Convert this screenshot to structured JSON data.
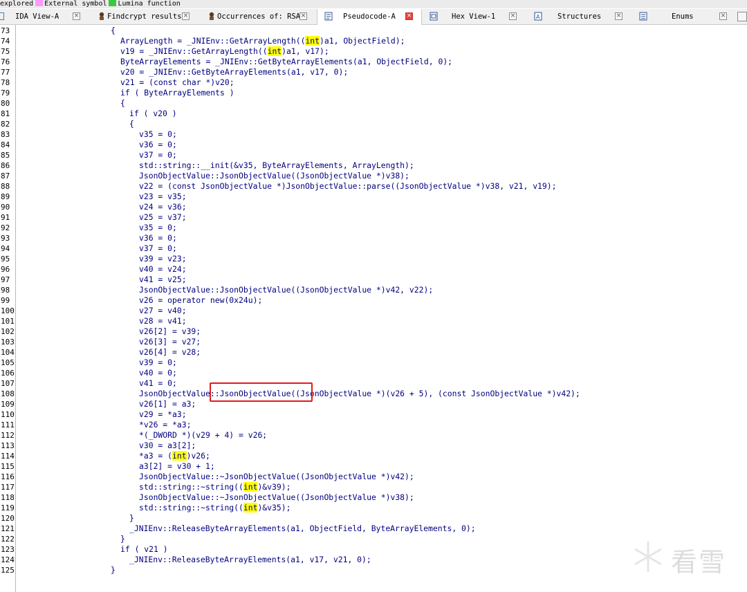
{
  "legend": {
    "items": [
      {
        "label": "explored",
        "color": null
      },
      {
        "label": "External symbol",
        "color": "#ff99ff"
      },
      {
        "label": "Lumina function",
        "color": "#3cc83c"
      }
    ]
  },
  "tabs": [
    {
      "label": "IDA View-A",
      "icon": "ida-view-icon",
      "active": false
    },
    {
      "label": "Findcrypt results",
      "icon": "findcrypt-icon",
      "active": false
    },
    {
      "label": "Occurrences of: RSA",
      "icon": "occurrences-icon",
      "active": false
    },
    {
      "label": "Pseudocode-A",
      "icon": "pseudocode-icon",
      "active": true
    },
    {
      "label": "Hex View-1",
      "icon": "hex-view-icon",
      "active": false
    },
    {
      "label": "Structures",
      "icon": "structures-icon",
      "active": false
    },
    {
      "label": "Enums",
      "icon": "enums-icon",
      "active": false
    }
  ],
  "colors": {
    "code_text": "#000080",
    "variable": "#0000a0",
    "highlight": "#ffff00",
    "annotation_box": "#e11a1a"
  },
  "code_lines": [
    {
      "num": "73",
      "text": "{"
    },
    {
      "num": "74",
      "text": "ArrayLength = _JNIEnv::GetArrayLength((int)a1, ObjectField);"
    },
    {
      "num": "75",
      "text": "v19 = _JNIEnv::GetArrayLength((int)a1, v17);"
    },
    {
      "num": "76",
      "text": "ByteArrayElements = _JNIEnv::GetByteArrayElements(a1, ObjectField, 0);"
    },
    {
      "num": "77",
      "text": "v20 = _JNIEnv::GetByteArrayElements(a1, v17, 0);"
    },
    {
      "num": "78",
      "text": "v21 = (const char *)v20;"
    },
    {
      "num": "79",
      "text": "if ( ByteArrayElements )"
    },
    {
      "num": "80",
      "text": "{"
    },
    {
      "num": "81",
      "text": "if ( v20 )"
    },
    {
      "num": "82",
      "text": "{"
    },
    {
      "num": "83",
      "text": "v35 = 0;"
    },
    {
      "num": "84",
      "text": "v36 = 0;"
    },
    {
      "num": "85",
      "text": "v37 = 0;"
    },
    {
      "num": "86",
      "text": "std::string::__init(&v35, ByteArrayElements, ArrayLength);"
    },
    {
      "num": "87",
      "text": "JsonObjectValue::JsonObjectValue((JsonObjectValue *)v38);"
    },
    {
      "num": "88",
      "text": "v22 = (const JsonObjectValue *)JsonObjectValue::parse((JsonObjectValue *)v38, v21, v19);"
    },
    {
      "num": "89",
      "text": "v23 = v35;"
    },
    {
      "num": "90",
      "text": "v24 = v36;"
    },
    {
      "num": "91",
      "text": "v25 = v37;"
    },
    {
      "num": "92",
      "text": "v35 = 0;"
    },
    {
      "num": "93",
      "text": "v36 = 0;"
    },
    {
      "num": "94",
      "text": "v37 = 0;"
    },
    {
      "num": "95",
      "text": "v39 = v23;"
    },
    {
      "num": "96",
      "text": "v40 = v24;"
    },
    {
      "num": "97",
      "text": "v41 = v25;"
    },
    {
      "num": "98",
      "text": "JsonObjectValue::JsonObjectValue((JsonObjectValue *)v42, v22);"
    },
    {
      "num": "99",
      "text": "v26 = operator new(0x24u);"
    },
    {
      "num": "100",
      "text": "v27 = v40;"
    },
    {
      "num": "101",
      "text": "v28 = v41;"
    },
    {
      "num": "102",
      "text": "v26[2] = v39;"
    },
    {
      "num": "103",
      "text": "v26[3] = v27;"
    },
    {
      "num": "104",
      "text": "v26[4] = v28;"
    },
    {
      "num": "105",
      "text": "v39 = 0;"
    },
    {
      "num": "106",
      "text": "v40 = 0;"
    },
    {
      "num": "107",
      "text": "v41 = 0;"
    },
    {
      "num": "108",
      "text": "JsonObjectValue::JsonObjectValue((JsonObjectValue *)(v26 + 5), (const JsonObjectValue *)v42);"
    },
    {
      "num": "109",
      "text": "v26[1] = a3;"
    },
    {
      "num": "110",
      "text": "v29 = *a3;"
    },
    {
      "num": "111",
      "text": "*v26 = *a3;"
    },
    {
      "num": "112",
      "text": "*(_DWORD *)(v29 + 4) = v26;"
    },
    {
      "num": "113",
      "text": "v30 = a3[2];"
    },
    {
      "num": "114",
      "text": "*a3 = (int)v26;"
    },
    {
      "num": "115",
      "text": "a3[2] = v30 + 1;"
    },
    {
      "num": "116",
      "text": "JsonObjectValue::~JsonObjectValue((JsonObjectValue *)v42);"
    },
    {
      "num": "117",
      "text": "std::string::~string((int)&v39);"
    },
    {
      "num": "118",
      "text": "JsonObjectValue::~JsonObjectValue((JsonObjectValue *)v38);"
    },
    {
      "num": "119",
      "text": "std::string::~string((int)&v35);"
    },
    {
      "num": "120",
      "text": "}"
    },
    {
      "num": "121",
      "text": "_JNIEnv::ReleaseByteArrayElements(a1, ObjectField, ByteArrayElements, 0);"
    },
    {
      "num": "122",
      "text": "}"
    },
    {
      "num": "123",
      "text": "if ( v21 )"
    },
    {
      "num": "124",
      "text": "_JNIEnv::ReleaseByteArrayElements(a1, v17, v21, 0);"
    },
    {
      "num": "125",
      "text": "}"
    }
  ],
  "watermark": {
    "text": "看雪"
  }
}
